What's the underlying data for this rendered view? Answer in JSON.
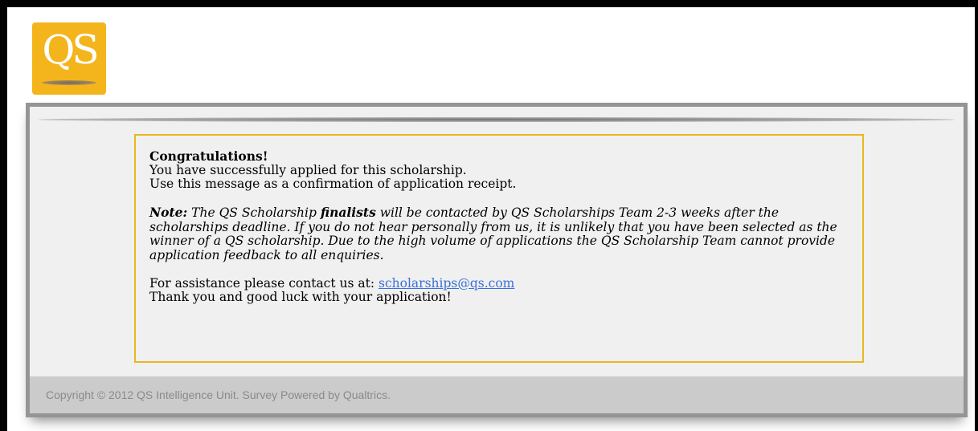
{
  "logo": {
    "text": "QS",
    "color": "#f4b41c"
  },
  "message": {
    "heading": "Congratulations!",
    "line1": "You have successfully applied for this scholarship.",
    "line2": "Use this message as a confirmation of application receipt.",
    "note_label": "Note:",
    "note_part1": " The QS Scholarship ",
    "note_bold": "finalists",
    "note_part2": " will be contacted by QS Scholarships Team 2-3 weeks after the scholarships deadline. If you do not hear personally from us, it is unlikely that you have been selected as the winner of a QS scholarship. Due to the high volume of applications the QS Scholarship Team cannot provide application feedback to all enquiries.",
    "assistance_text": "For assistance please contact us at: ",
    "email": "scholarships@qs.com",
    "closing": "Thank you and good luck with your application!",
    "border_color": "#e9b81e",
    "link_color": "#3a6fd8"
  },
  "footer": {
    "copyright": "Copyright © 2012 QS Intelligence Unit. Survey Powered by Qualtrics."
  }
}
